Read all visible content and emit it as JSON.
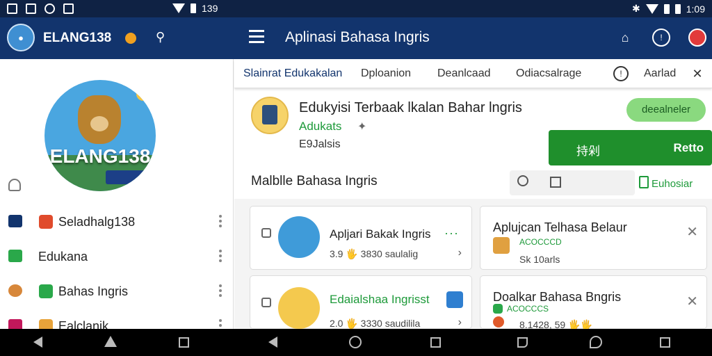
{
  "status": {
    "left_time": "139",
    "right_time": "1:09"
  },
  "appbar": {
    "app_name": "ELANG138",
    "title": "Aplinasi Bahasa Ingris"
  },
  "drawer": {
    "avatar_text": "ELANG138",
    "items": [
      {
        "label": "Seladhalg138"
      },
      {
        "label": "Edukana"
      },
      {
        "label": "Bahas Ingris"
      },
      {
        "label": "Ealclanik"
      }
    ]
  },
  "tabs": [
    "Slainrat Edukakalan",
    "Dploanion",
    "Deanlcaad",
    "Odiacsalrage",
    "Aarlad"
  ],
  "hero": {
    "title": "Edukyisi Terbaak lkalan Bahar lngris",
    "publisher": "Adukats",
    "rating": "E9Jalsis",
    "pill": "deealneler",
    "install_left": "持剁",
    "install_right": "Retto"
  },
  "section": {
    "title": "Malblle Bahasa Ingris",
    "filter": "Euhosiar"
  },
  "cards": [
    {
      "title": "Apljari Bakak Ingris",
      "meta": "3.9  🖐  3830 saulalig"
    },
    {
      "title": "Aplujcan Telhasa Belaur",
      "sub": "ACOCCCD",
      "meta": "Sk 10arls"
    },
    {
      "title": "Edaialshaa Ingrisst",
      "meta": "2.0  🖐  3330 saudilila"
    },
    {
      "title": "Doalkar Bahasa Bngris",
      "sub": "ACOCCCS",
      "meta": "8.1428, 59  🖐🖐"
    }
  ]
}
